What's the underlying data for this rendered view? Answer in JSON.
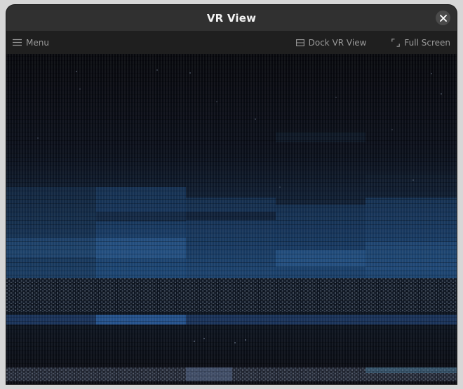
{
  "window": {
    "title": "VR View"
  },
  "toolbar": {
    "menu_label": "Menu",
    "dock_label": "Dock VR View",
    "fullscreen_label": "Full Screen"
  },
  "icons": {
    "close": "close-icon",
    "menu": "hamburger-icon",
    "dock": "dock-icon",
    "fullscreen": "fullscreen-icon"
  },
  "colors": {
    "titlebar": "#303030",
    "toolbar": "#1f1f1f",
    "viewport_bg": "#0a0b10",
    "scene_blue": "#1e4a7a"
  }
}
